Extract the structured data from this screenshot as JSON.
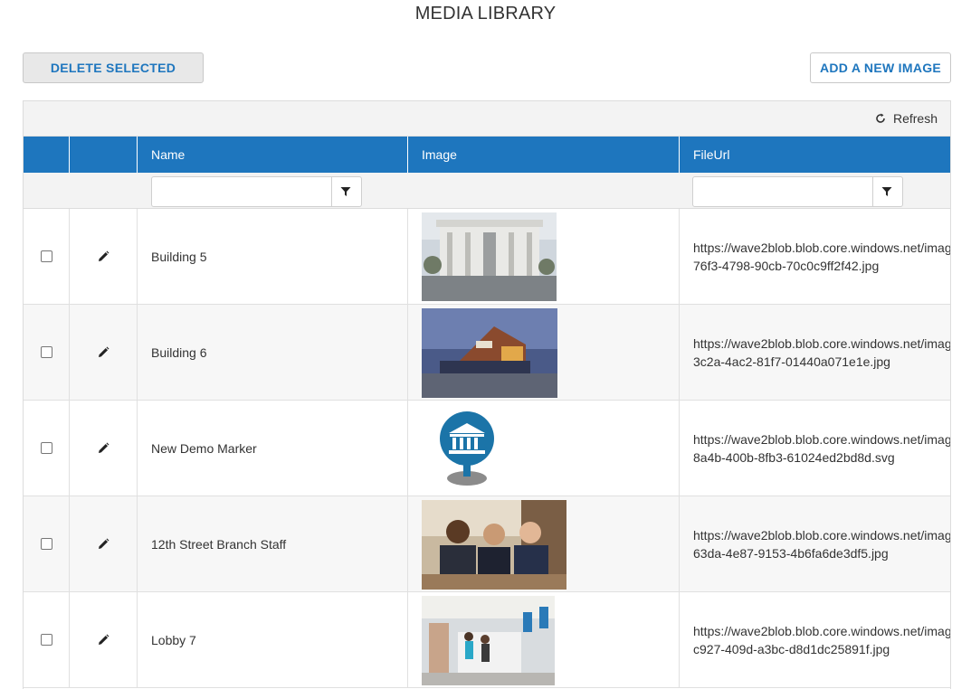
{
  "page_title": "MEDIA LIBRARY",
  "buttons": {
    "delete_selected": "DELETE SELECTED",
    "add_new_image": "ADD A NEW IMAGE"
  },
  "toolbar": {
    "refresh_label": "Refresh",
    "refresh_icon": "refresh-icon"
  },
  "columns": [
    "",
    "",
    "Name",
    "Image",
    "FileUrl"
  ],
  "filters": {
    "name_value": "",
    "fileurl_value": "",
    "filter_icon": "filter-icon"
  },
  "colors": {
    "accent": "#1e76be",
    "header_bg": "#1e76be",
    "toolbar_bg": "#f3f3f3"
  },
  "rows": [
    {
      "name": "Building 5",
      "url_line1": "https://wave2blob.blob.core.windows.net/imag",
      "url_line2": "76f3-4798-90cb-70c0c9ff2f42.jpg",
      "image": "building-photo"
    },
    {
      "name": "Building 6",
      "url_line1": "https://wave2blob.blob.core.windows.net/imag",
      "url_line2": "3c2a-4ac2-81f7-01440a071e1e.jpg",
      "image": "modern-bank-building-photo"
    },
    {
      "name": "New Demo Marker",
      "url_line1": "https://wave2blob.blob.core.windows.net/imag",
      "url_line2": "8a4b-400b-8fb3-61024ed2bd8d.svg",
      "image": "bank-marker-icon"
    },
    {
      "name": "12th Street Branch Staff",
      "url_line1": "https://wave2blob.blob.core.windows.net/imag",
      "url_line2": "63da-4e87-9153-4b6fa6de3df5.jpg",
      "image": "staff-photo"
    },
    {
      "name": "Lobby 7",
      "url_line1": "https://wave2blob.blob.core.windows.net/imag",
      "url_line2": "c927-409d-a3bc-d8d1dc25891f.jpg",
      "image": "lobby-photo"
    }
  ]
}
